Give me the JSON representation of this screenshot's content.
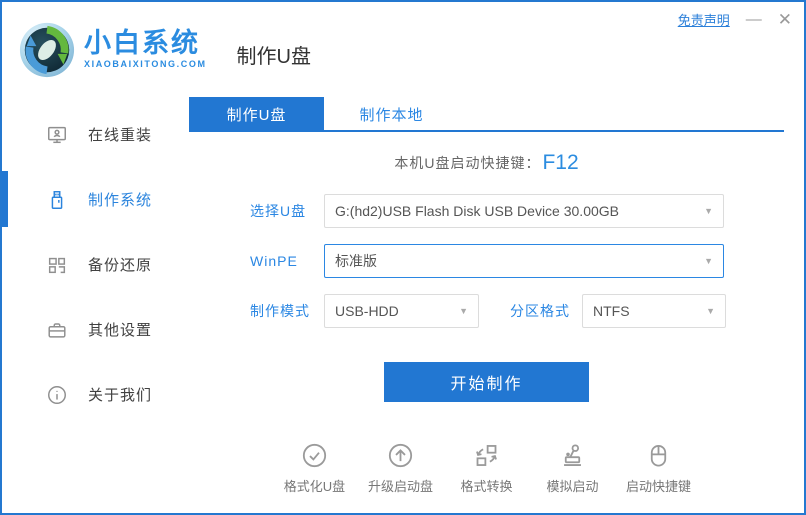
{
  "colors": {
    "accent": "#2277D2",
    "link_blue": "#2B87E3",
    "brand_blue": "#2B8CE0"
  },
  "header": {
    "brand": "小白系统",
    "brand_domain": "XIAOBAIXITONG.COM",
    "page_title": "制作U盘",
    "disclaimer": "免责声明",
    "minimize": "—",
    "close": "✕"
  },
  "sidebar": {
    "items": [
      {
        "label": "在线重装",
        "icon": "monitor-icon",
        "active": false
      },
      {
        "label": "制作系统",
        "icon": "usb-drive-icon",
        "active": true
      },
      {
        "label": "备份还原",
        "icon": "grid-icon",
        "active": false
      },
      {
        "label": "其他设置",
        "icon": "briefcase-icon",
        "active": false
      },
      {
        "label": "关于我们",
        "icon": "info-icon",
        "active": false
      }
    ]
  },
  "main": {
    "tabs": [
      {
        "label": "制作U盘",
        "active": true
      },
      {
        "label": "制作本地",
        "active": false
      }
    ],
    "hotkey_label": "本机U盘启动快捷键：",
    "hotkey_value": "F12",
    "fields": {
      "usb": {
        "label": "选择U盘",
        "value": "G:(hd2)USB Flash Disk USB Device 30.00GB"
      },
      "winpe": {
        "label": "WinPE",
        "value": "标准版"
      },
      "mode": {
        "label": "制作模式",
        "value": "USB-HDD"
      },
      "partition": {
        "label": "分区格式",
        "value": "NTFS"
      }
    },
    "start_button": "开始制作",
    "tools": [
      {
        "label": "格式化U盘",
        "icon": "check-circle-icon"
      },
      {
        "label": "升级启动盘",
        "icon": "arrow-up-circle-icon"
      },
      {
        "label": "格式转换",
        "icon": "convert-icon"
      },
      {
        "label": "模拟启动",
        "icon": "stamp-icon"
      },
      {
        "label": "启动快捷键",
        "icon": "mouse-icon"
      }
    ]
  }
}
